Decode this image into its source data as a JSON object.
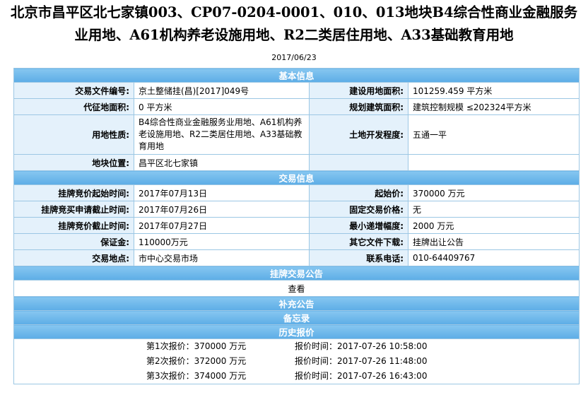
{
  "page": {
    "title": "北京市昌平区北七家镇003、CP07-0204-0001、010、013地块B4综合性商业金融服务业用地、A61机构养老设施用地、R2二类居住用地、A33基础教育用地",
    "date": "2017/06/23"
  },
  "basic": {
    "header": "基本信息",
    "rows": [
      {
        "l1": "交易文件编号:",
        "v1": "京土整储挂(昌)[2017]049号",
        "l2": "建设用地面积:",
        "v2": "101259.459 平方米"
      },
      {
        "l1": "代征地面积:",
        "v1": "0 平方米",
        "l2": "规划建筑面积:",
        "v2": "建筑控制规模 ≤202324平方米"
      },
      {
        "l1": "用地性质:",
        "v1": "B4综合性商业金融服务业用地、A61机构养老设施用地、R2二类居住用地、A33基础教育用地",
        "l2": "土地开发程度:",
        "v2": "五通一平"
      },
      {
        "l1": "地块位置:",
        "v1": "昌平区北七家镇",
        "l2": "",
        "v2": ""
      }
    ]
  },
  "trade": {
    "header": "交易信息",
    "rows": [
      {
        "l1": "挂牌竞价起始时间:",
        "v1": "2017年07月13日",
        "l2": "起始价:",
        "v2": "370000 万元"
      },
      {
        "l1": "挂牌竞买申请截止时间:",
        "v1": "2017年07月26日",
        "l2": "固定交易价格:",
        "v2": "无"
      },
      {
        "l1": "挂牌竞价截止时间:",
        "v1": "2017年07月27日",
        "l2": "最小递增幅度:",
        "v2": "2000 万元"
      },
      {
        "l1": "保证金:",
        "v1": "110000万元",
        "l2": "其它文件下载:",
        "v2": "挂牌出让公告"
      },
      {
        "l1": "交易地点:",
        "v1": "市中心交易市场",
        "l2": "联系电话:",
        "v2": "010-64409767"
      }
    ]
  },
  "announcement": {
    "header": "挂牌交易公告",
    "view_link": "查看"
  },
  "supplement": {
    "header": "补充公告"
  },
  "memo": {
    "header": "备忘录"
  },
  "history": {
    "header": "历史报价",
    "bids": [
      {
        "price": "第1次报价：370000 万元",
        "time": "报价时间：2017-07-26 10:58:00"
      },
      {
        "price": "第2次报价：372000 万元",
        "time": "报价时间：2017-07-26 11:48:00"
      },
      {
        "price": "第3次报价：374000 万元",
        "time": "报价时间：2017-07-26 16:43:00"
      }
    ]
  }
}
